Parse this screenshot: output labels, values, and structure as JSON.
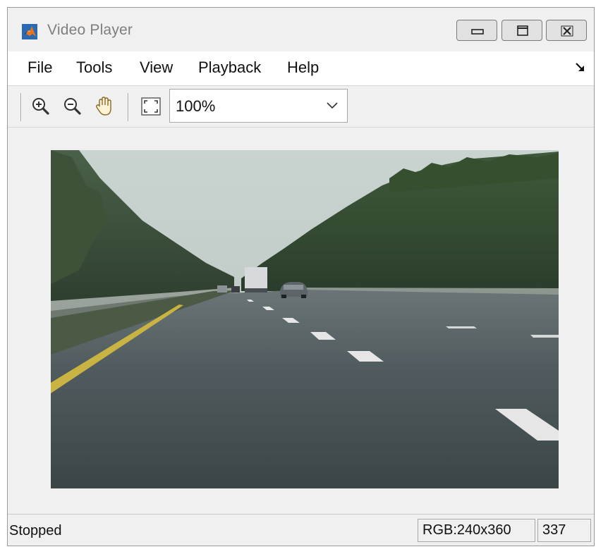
{
  "window": {
    "title": "Video Player",
    "title_color": "#7e7e7e",
    "icon": "matlab-logo-icon",
    "controls": [
      "minimize-icon",
      "maximize-icon",
      "close-icon"
    ]
  },
  "menu": {
    "items": [
      {
        "label": "File"
      },
      {
        "label": "Tools"
      },
      {
        "label": "View"
      },
      {
        "label": "Playback"
      },
      {
        "label": "Help"
      }
    ],
    "dock_icon": "dock-arrow-icon"
  },
  "toolbar": {
    "icons": [
      "zoom-in-icon",
      "zoom-out-icon",
      "pan-hand-icon",
      "fit-to-window-icon"
    ],
    "zoom": {
      "value": "100%",
      "caret_icon": "chevron-down-icon"
    }
  },
  "video": {
    "scene": "highway road viewed from driving car"
  },
  "status": {
    "state": "Stopped",
    "format": "RGB:240x360",
    "frame": "337"
  }
}
